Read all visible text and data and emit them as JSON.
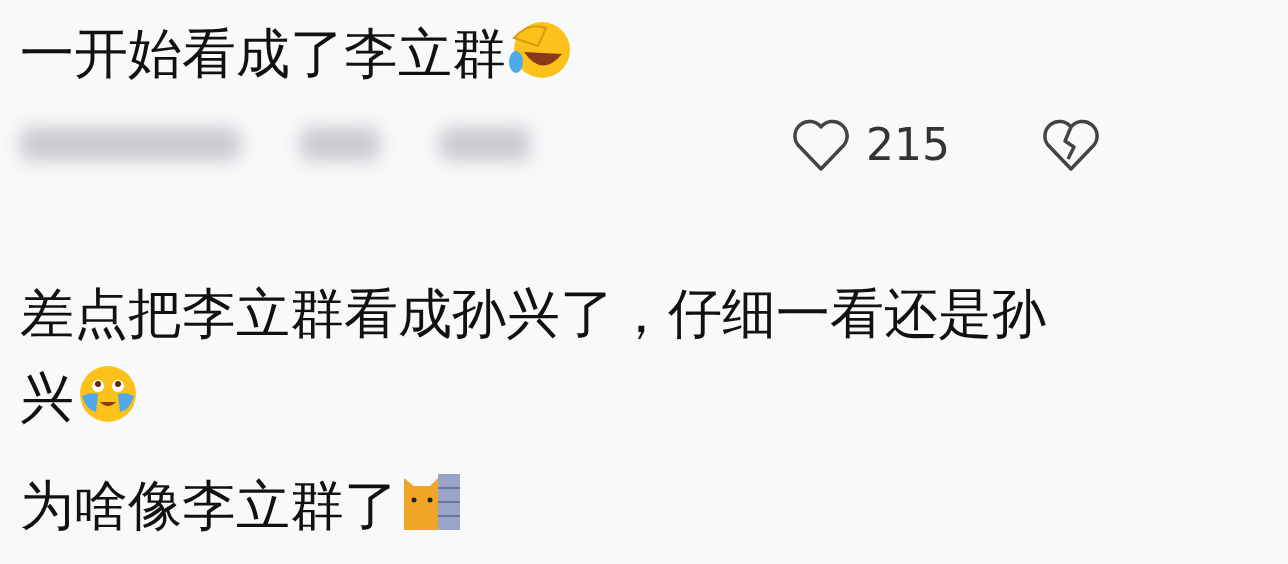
{
  "comments": [
    {
      "text": "一开始看成了李立群",
      "emoji": {
        "kind": "laughing"
      },
      "actions": {
        "likes": "215"
      }
    },
    {
      "text": "差点把李立群看成孙兴了，仔细一看还是孙兴",
      "emoji": {
        "kind": "crying"
      }
    },
    {
      "text": "为啥像李立群了",
      "emoji": {
        "kind": "cat"
      }
    }
  ]
}
